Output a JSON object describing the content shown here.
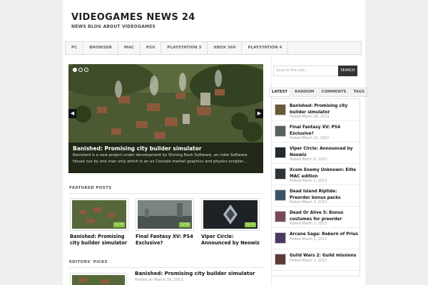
{
  "site": {
    "title": "VIDEOGAMES NEWS 24",
    "description": "NEWS BLOG ABOUT VIDEOGAMES"
  },
  "nav": [
    "PC",
    "BROWSER",
    "MAC",
    "PSV",
    "PLAYSTATION 3",
    "XBOX 360",
    "PLAYSTATION 4"
  ],
  "slider": {
    "title": "Banished: Promising city builder simulator",
    "excerpt": "Banished is a new project under development by Shining Rock Software, an indie Software House run by one man only which is an ex Console market graphics and physics scripter…",
    "prev_icon": "chevron-left-icon",
    "next_icon": "chevron-right-icon"
  },
  "featured": {
    "heading": "FEATURED POSTS",
    "posts": [
      {
        "title": "Banished: Promising city builder simulator",
        "comments": "0"
      },
      {
        "title": "Final Fantasy XV: PS4 Exclusive?",
        "comments": "0"
      },
      {
        "title": "Viper Circle: Announced by Neowiz",
        "comments": "0"
      }
    ]
  },
  "editors": {
    "heading": "EDITORS' PICKS",
    "title": "Banished: Promising city builder simulator",
    "date": "Posted on March 26, 2013"
  },
  "sidebar": {
    "search_placeholder": "Search the site…",
    "search_button": "SEARCH",
    "tabs": [
      "LATEST",
      "RANDOM",
      "COMMENTS",
      "TAGS"
    ],
    "posts": [
      {
        "title": "Banished: Promising city builder simulator",
        "date": "Posted March 26, 2013"
      },
      {
        "title": "Final Fantasy XV: PS4 Exclusive?",
        "date": "Posted March 21, 2013"
      },
      {
        "title": "Viper Circle: Announced by Neowiz",
        "date": "Posted March 8, 2013"
      },
      {
        "title": "Xcom Enemy Unknown: Elite MAC edition",
        "date": "Posted March 3, 2013"
      },
      {
        "title": "Dead Island Riptide: Preorder bonus packs",
        "date": "Posted March 3, 2013"
      },
      {
        "title": "Dead Or Alive 5: Bonus costumes for preorder",
        "date": "Posted March 2, 2013"
      },
      {
        "title": "Arcane Saga: Reborn of Prius",
        "date": "Posted March 1, 2013"
      },
      {
        "title": "Guild Wars 2: Guild missions",
        "date": "Posted March 1, 2013"
      }
    ]
  },
  "colors": {
    "badge": "#8ac543",
    "dark": "#333333"
  }
}
